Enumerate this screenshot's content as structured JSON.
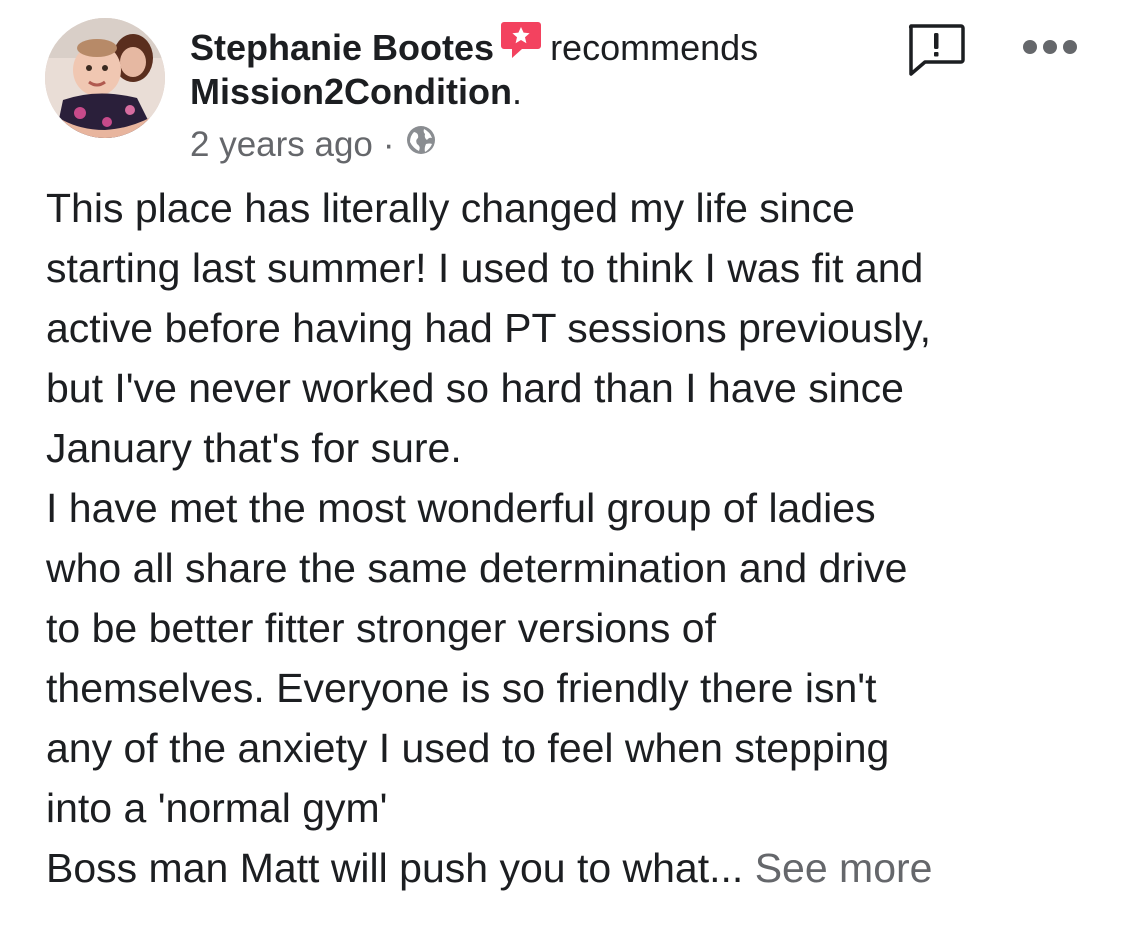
{
  "post": {
    "author": "Stephanie Bootes",
    "verb": "recommends",
    "page_name": "Mission2Condition",
    "page_name_suffix": ".",
    "time_ago": "2 years ago",
    "separator": "·",
    "privacy_icon": "globe-icon",
    "recommend_icon": "recommend-badge-icon",
    "report_icon": "report-exclamation-icon",
    "more_icon": "more-horizontal-icon",
    "body_lines": [
      "This place has literally changed my life since",
      "starting last summer! I used to think I was fit and",
      "active before having had PT sessions previously,",
      "but I've never worked so hard than I have since",
      "January that's for sure.",
      "I have met the most wonderful group of ladies",
      "who all share the same determination and drive",
      "to be better fitter stronger versions of",
      "themselves. Everyone is so friendly there isn't",
      "any of the anxiety I used to feel when stepping",
      "into a 'normal gym'",
      "Boss man Matt will push you to what... "
    ],
    "see_more": "See more"
  },
  "colors": {
    "text": "#1c1e21",
    "secondary_text": "#65676b",
    "recommend_badge": "#f3425f",
    "background": "#ffffff"
  }
}
